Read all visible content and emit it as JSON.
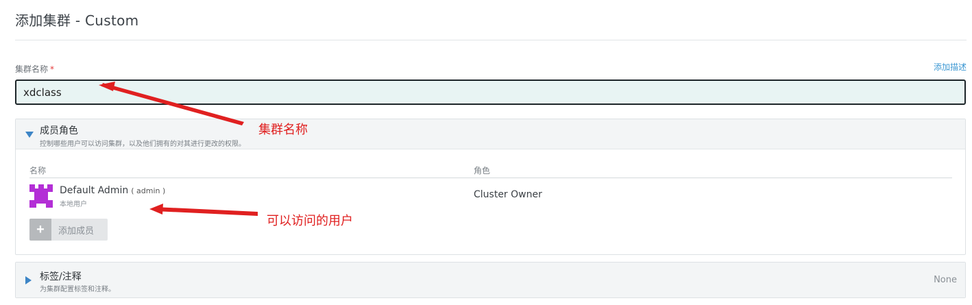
{
  "page": {
    "title": "添加集群 - Custom"
  },
  "cluster_name": {
    "label": "集群名称",
    "required_mark": "*",
    "add_description_link": "添加描述",
    "value": "xdclass"
  },
  "members_panel": {
    "title": "成员角色",
    "subtitle": "控制哪些用户可以访问集群，以及他们拥有的对其进行更改的权限。",
    "expanded": true,
    "columns": {
      "name": "名称",
      "role": "角色"
    },
    "members": [
      {
        "name": "Default  Admin",
        "id_text": "( admin )",
        "type": "本地用户",
        "role": "Cluster Owner",
        "avatar_color": "#b32fd6"
      }
    ],
    "add_member_label": "添加成员",
    "add_member_icon": "plus-icon"
  },
  "labels_panel": {
    "title": "标签/注释",
    "subtitle": "为集群配置标签和注释。",
    "expanded": false,
    "value": "None"
  },
  "annotations": {
    "cluster_name_note": "集群名称",
    "users_note": "可以访问的用户",
    "color": "#e02020"
  },
  "colors": {
    "accent": "#3d85c6",
    "link": "#3d98d3",
    "input_bg": "#e8f4f3"
  }
}
